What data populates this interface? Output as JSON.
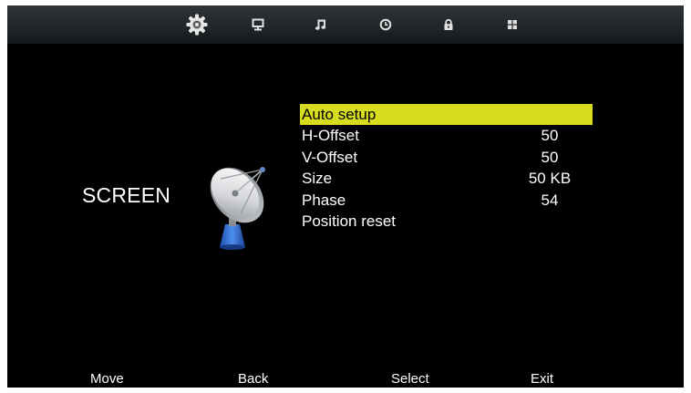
{
  "top_tabs": [
    {
      "icon": "gear-icon",
      "active": true
    },
    {
      "icon": "monitor-icon",
      "active": false
    },
    {
      "icon": "music-note-icon",
      "active": false
    },
    {
      "icon": "clock-icon",
      "active": false
    },
    {
      "icon": "lock-icon",
      "active": false
    },
    {
      "icon": "grid-icon",
      "active": false
    }
  ],
  "section": {
    "title": "SCREEN",
    "icon": "satellite-dish-icon"
  },
  "menu": {
    "items": [
      {
        "label": "Auto setup",
        "value": "",
        "selected": true
      },
      {
        "label": "H-Offset",
        "value": "50",
        "selected": false
      },
      {
        "label": "V-Offset",
        "value": "50",
        "selected": false
      },
      {
        "label": "Size",
        "value": "50 KB",
        "selected": false
      },
      {
        "label": "Phase",
        "value": "54",
        "selected": false
      },
      {
        "label": "Position reset",
        "value": "",
        "selected": false
      }
    ]
  },
  "footer": {
    "move": "Move",
    "back": "Back",
    "select": "Select",
    "exit": "Exit"
  },
  "colors": {
    "highlight": "#d7dc1f",
    "background": "#000000",
    "text": "#ffffff"
  }
}
